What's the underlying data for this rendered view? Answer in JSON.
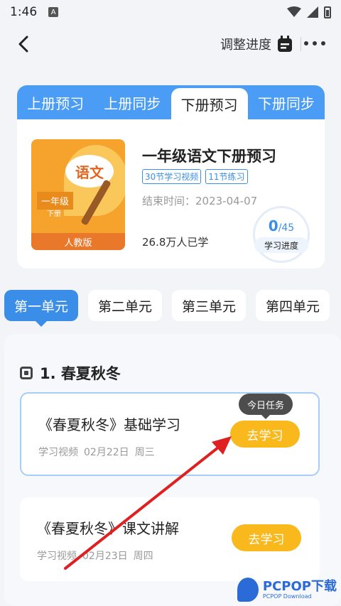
{
  "status_bar": {
    "time": "1:46",
    "notif_letter": "A"
  },
  "header": {
    "adjust_label": "调整进度"
  },
  "course": {
    "tabs": [
      "上册预习",
      "上册同步",
      "下册预习",
      "下册同步"
    ],
    "active_tab": 2,
    "cover": {
      "title": "语文",
      "grade": "一年级",
      "volume": "下册",
      "edition": "人教版"
    },
    "name": "一年级语文下册预习",
    "badges": [
      "30节学习视频",
      "11节练习"
    ],
    "end_time": "结束时间：2023-04-07",
    "learners": "26.8万人已学",
    "progress": {
      "done": "0",
      "total": "/45",
      "label": "学习进度"
    }
  },
  "units": [
    "第一单元",
    "第二单元",
    "第三单元",
    "第四单元"
  ],
  "lesson": {
    "title": "1. 春夏秋冬",
    "items": [
      {
        "title": "《春夏秋冬》基础学习",
        "type": "学习视频",
        "date": "02月22日",
        "weekday": "周三",
        "button": "去学习",
        "tip": "今日任务"
      },
      {
        "title": "《春夏秋冬》课文讲解",
        "type": "学习视频",
        "date": "02月23日",
        "weekday": "周四",
        "button": "去学习"
      }
    ]
  },
  "watermark": {
    "brand": "PCPOP下载",
    "sub": "PCPOP Download"
  },
  "colors": {
    "accent": "#3b8ee8",
    "tab_bar": "#4a9cf4",
    "button": "#f9b81b",
    "arrow": "#e02020"
  }
}
